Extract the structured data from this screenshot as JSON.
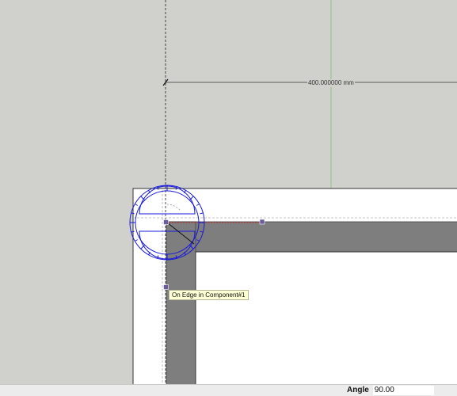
{
  "dimension": {
    "label": "400.000000 mm"
  },
  "tooltip": {
    "text": "On Edge in Component#1"
  },
  "status_bar": {
    "measure_label": "Angle",
    "measure_value": "90.00"
  },
  "colors": {
    "background": "#d0d1cc",
    "green_axis": "#8fbf86",
    "protractor": "#1a1ad9",
    "wall_fill": "#7e7e7e",
    "inference_line": "#cc3333",
    "grip_point": "#6b5a9e",
    "tooltip_bg": "#fefed4"
  },
  "icons": {
    "protractor": "protractor-icon"
  }
}
